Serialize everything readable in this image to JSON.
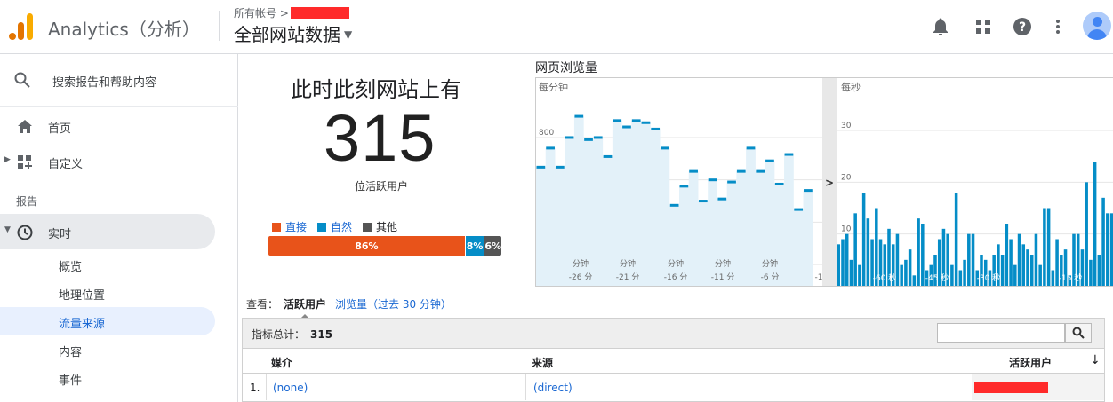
{
  "topbar": {
    "app_title": "Analytics（分析）",
    "account_crumb": "所有帐号 >",
    "property_title": "全部网站数据",
    "icons": [
      "bell-icon",
      "apps-grid-icon",
      "help-icon",
      "more-vert-icon",
      "avatar"
    ]
  },
  "sidebar": {
    "search_placeholder": "搜索报告和帮助内容",
    "items": [
      {
        "label": "首页",
        "icon": "home-icon"
      },
      {
        "label": "自定义",
        "icon": "customize-icon"
      }
    ],
    "section_label": "报告",
    "realtime_label": "实时",
    "realtime_sub": [
      "概览",
      "地理位置",
      "流量来源",
      "内容",
      "事件"
    ],
    "active_sub": "流量来源"
  },
  "overview": {
    "headline": "此时此刻网站上有",
    "active_users": "315",
    "units": "位活跃用户",
    "legend": [
      {
        "label": "直接",
        "color": "#e8531a"
      },
      {
        "label": "自然",
        "color": "#058dc7"
      },
      {
        "label": "其他",
        "color": "#555555"
      }
    ],
    "segments": [
      {
        "label": "86%",
        "value": 86,
        "color": "#e8531a"
      },
      {
        "label": "8%",
        "value": 8,
        "color": "#058dc7"
      },
      {
        "label": "6%",
        "value": 6,
        "color": "#555555"
      }
    ]
  },
  "pageviews": {
    "title": "网页浏览量",
    "per_minute_label": "每分钟",
    "per_second_label": "每秒",
    "expand_arrow": ">"
  },
  "chart_data": [
    {
      "type": "bar",
      "subtitle": "每分钟",
      "ylim": [
        100,
        980
      ],
      "yticks": [
        200,
        400,
        600,
        800
      ],
      "xtick_labels": [
        "-26 分钟",
        "-21 分钟",
        "-16 分钟",
        "-11 分钟",
        "-6 分钟",
        "-1"
      ],
      "values": [
        660,
        750,
        660,
        800,
        900,
        790,
        800,
        710,
        880,
        850,
        880,
        870,
        840,
        750,
        480,
        570,
        640,
        500,
        600,
        510,
        590,
        640,
        750,
        640,
        690,
        580,
        720,
        460,
        550,
        90
      ]
    },
    {
      "type": "bar",
      "subtitle": "每秒",
      "ylim": [
        0,
        36
      ],
      "yticks": [
        10,
        20,
        30
      ],
      "xtick_labels": [
        "-60 秒",
        "-45 秒",
        "-30 秒",
        "-15 秒"
      ],
      "values": [
        8,
        9,
        10,
        5,
        14,
        4,
        18,
        13,
        9,
        15,
        9,
        8,
        11,
        8,
        10,
        4,
        5,
        7,
        2,
        13,
        12,
        3,
        4,
        6,
        9,
        11,
        10,
        4,
        18,
        3,
        5,
        10,
        10,
        3,
        6,
        5,
        3,
        6,
        8,
        6,
        12,
        9,
        4,
        10,
        8,
        7,
        6,
        10,
        4,
        15,
        15,
        3,
        9,
        6,
        7,
        2,
        10,
        10,
        7,
        20,
        5,
        24,
        6,
        17,
        14,
        14
      ]
    }
  ],
  "view_tabs": {
    "label": "查看：",
    "active": "活跃用户",
    "other": "浏览量（过去 30 分钟）"
  },
  "table": {
    "total_label": "指标总计：",
    "total_value": "315",
    "search_value": "",
    "columns": [
      "媒介",
      "来源",
      "活跃用户"
    ],
    "rows": [
      {
        "index": "1.",
        "medium": "(none)",
        "source": "(direct)"
      }
    ]
  }
}
